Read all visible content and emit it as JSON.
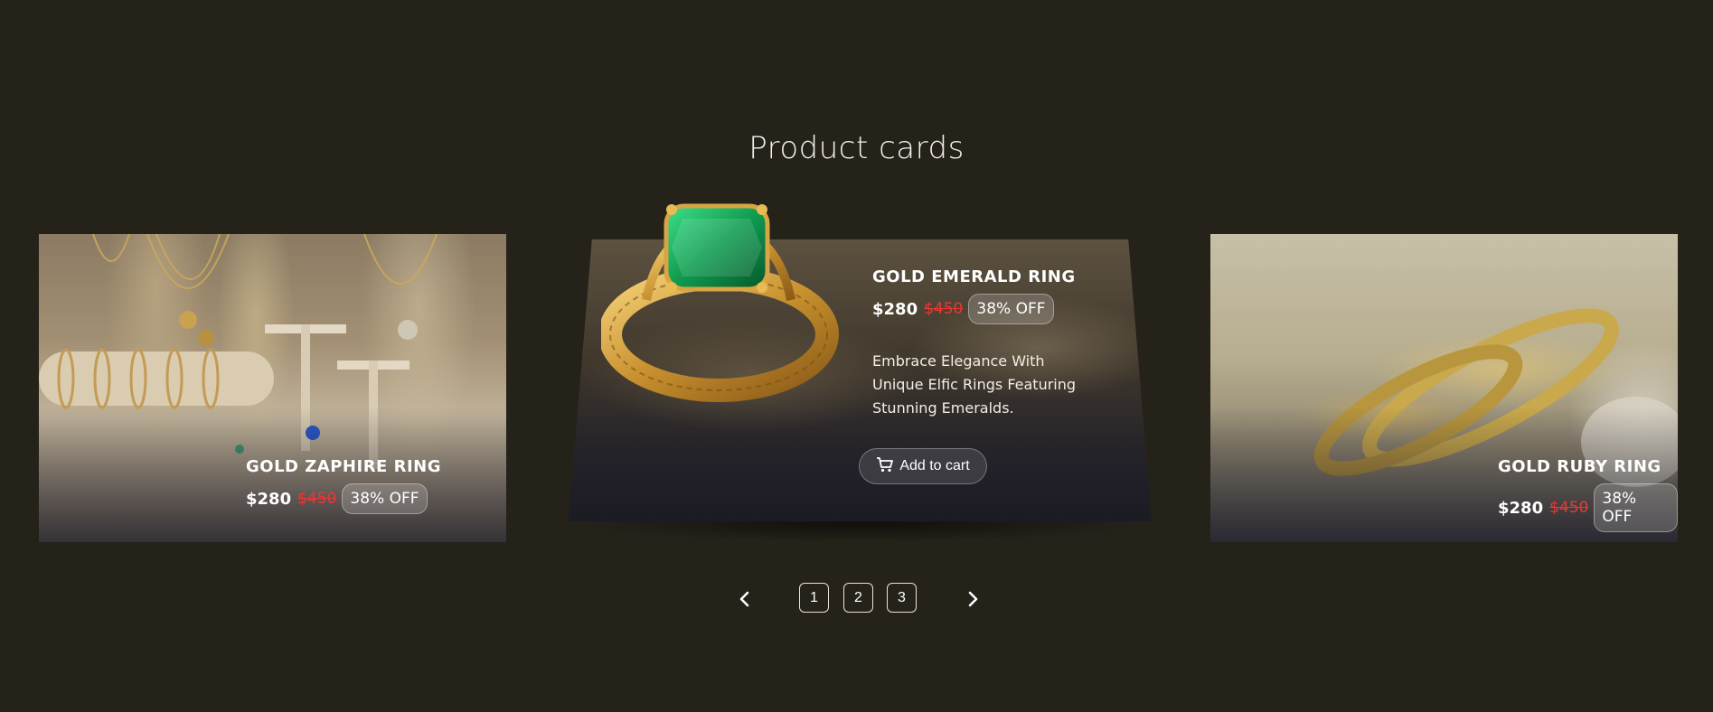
{
  "page": {
    "title": "Product cards"
  },
  "cards": [
    {
      "name": "GOLD ZAPHIRE RING",
      "price": "$280",
      "old_price": "$450",
      "discount": "38% OFF",
      "image": "jewelry-display-photo"
    },
    {
      "name": "GOLD EMERALD RING",
      "price": "$280",
      "old_price": "$450",
      "discount": "38% OFF",
      "description": "Embrace Elegance With Unique Elfic Rings Featuring Stunning Emeralds.",
      "cta": "Add to cart",
      "cta_icon": "cart-icon",
      "image": "emerald-ring-photo"
    },
    {
      "name": "GOLD RUBY RING",
      "price": "$280",
      "old_price": "$450",
      "discount": "38% OFF",
      "image": "gold-bands-photo"
    }
  ],
  "pagination": {
    "prev_icon": "chevron-left-icon",
    "next_icon": "chevron-right-icon",
    "pages": [
      "1",
      "2",
      "3"
    ]
  },
  "colors": {
    "background": "#25221a",
    "old_price": "#e53935",
    "text": "#ffffff"
  }
}
